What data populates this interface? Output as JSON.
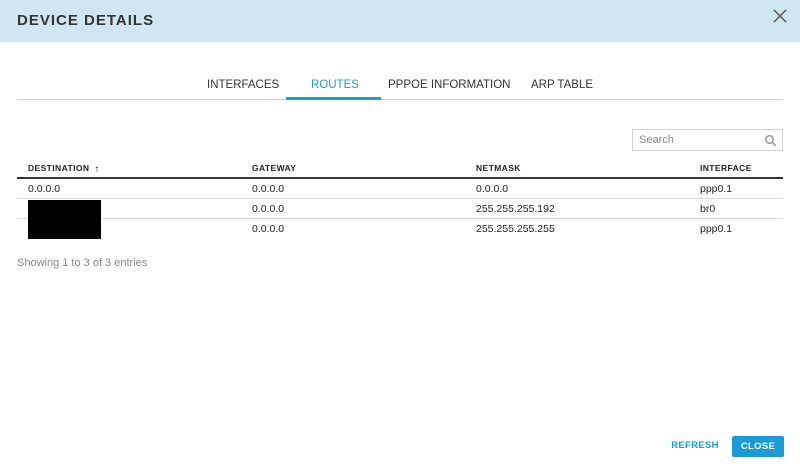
{
  "dialog": {
    "title": "DEVICE DETAILS",
    "close_icon": "close-icon"
  },
  "tabs": [
    {
      "label": "INTERFACES",
      "active": false
    },
    {
      "label": "ROUTES",
      "active": true
    },
    {
      "label": "PPPOE INFORMATION",
      "active": false
    },
    {
      "label": "ARP TABLE",
      "active": false
    }
  ],
  "search": {
    "placeholder": "Search",
    "value": "",
    "icon": "search-icon"
  },
  "table": {
    "columns": [
      "DESTINATION",
      "GATEWAY",
      "NETMASK",
      "INTERFACE"
    ],
    "sort_column": "DESTINATION",
    "sort_direction": "ascending",
    "rows": [
      {
        "destination": "0.0.0.0",
        "gateway": "0.0.0.0",
        "netmask": "0.0.0.0",
        "interface": "ppp0.1"
      },
      {
        "destination": "",
        "gateway": "0.0.0.0",
        "netmask": "255.255.255.192",
        "interface": "br0"
      },
      {
        "destination": "",
        "gateway": "0.0.0.0",
        "netmask": "255.255.255.255",
        "interface": "ppp0.1"
      }
    ]
  },
  "footer": {
    "entries_text": "Showing 1 to 3 of 3 entries",
    "refresh_label": "REFRESH",
    "close_label": "CLOSE"
  },
  "colors": {
    "accent": "#1a9ad6",
    "titlebar": "#cfe7f2"
  }
}
